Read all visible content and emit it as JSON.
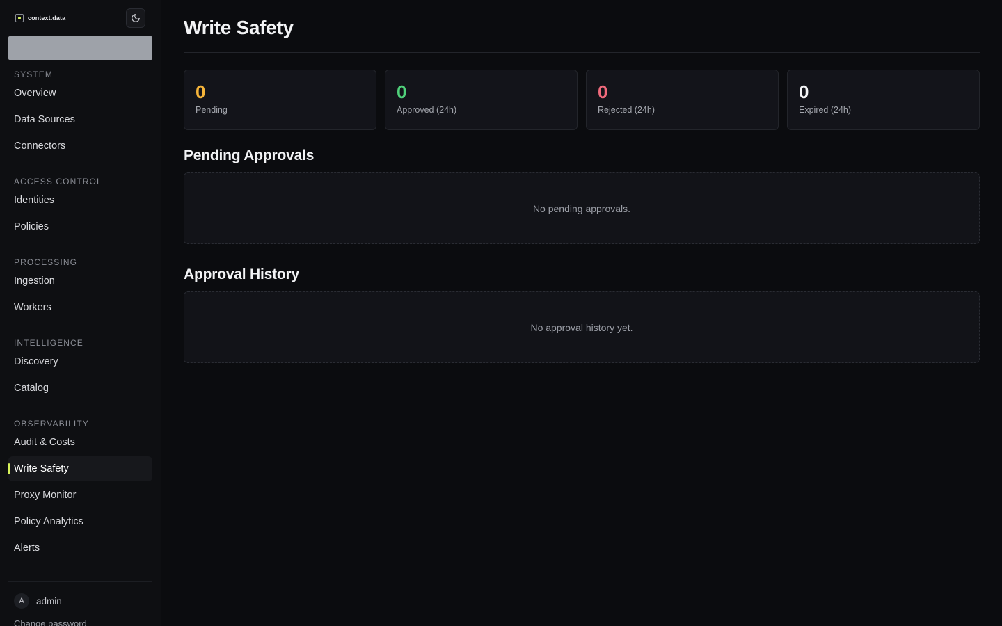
{
  "brand": {
    "name": "context.data"
  },
  "sidebar": {
    "groups": [
      {
        "label": "SYSTEM",
        "items": [
          "Overview",
          "Data Sources",
          "Connectors"
        ]
      },
      {
        "label": "ACCESS CONTROL",
        "items": [
          "Identities",
          "Policies"
        ]
      },
      {
        "label": "PROCESSING",
        "items": [
          "Ingestion",
          "Workers"
        ]
      },
      {
        "label": "INTELLIGENCE",
        "items": [
          "Discovery",
          "Catalog"
        ]
      },
      {
        "label": "OBSERVABILITY",
        "items": [
          "Audit & Costs",
          "Write Safety",
          "Proxy Monitor",
          "Policy Analytics",
          "Alerts"
        ]
      }
    ],
    "active_item": "Write Safety",
    "user": {
      "initial": "A",
      "name": "admin"
    },
    "change_password": "Change password",
    "theme_toggle_icon": "moon-icon"
  },
  "page": {
    "title": "Write Safety"
  },
  "stats": [
    {
      "value": "0",
      "label": "Pending",
      "color": "#f5b43a"
    },
    {
      "value": "0",
      "label": "Approved (24h)",
      "color": "#4fd17a"
    },
    {
      "value": "0",
      "label": "Rejected (24h)",
      "color": "#f06a7c"
    },
    {
      "value": "0",
      "label": "Expired (24h)",
      "color": "#f2f3f5"
    }
  ],
  "pending": {
    "title": "Pending Approvals",
    "empty_text": "No pending approvals."
  },
  "history": {
    "title": "Approval History",
    "empty_text": "No approval history yet."
  },
  "colors": {
    "accent": "#d7f25a",
    "background": "#0b0c0f",
    "sidebar": "#0e0f12"
  }
}
